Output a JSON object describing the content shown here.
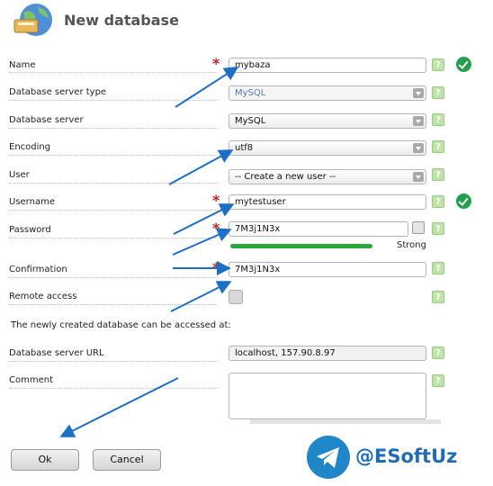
{
  "dialog": {
    "title": "New database"
  },
  "fields": {
    "name": {
      "label": "Name",
      "value": "mybaza"
    },
    "server_type": {
      "label": "Database server type",
      "value": "MySQL"
    },
    "server": {
      "label": "Database server",
      "value": "MySQL"
    },
    "encoding": {
      "label": "Encoding",
      "value": "utf8"
    },
    "user": {
      "label": "User",
      "value": "-- Create a new user --"
    },
    "username": {
      "label": "Username",
      "value": "mytestuser"
    },
    "password": {
      "label": "Password",
      "value": "7M3j1N3x",
      "strength_label": "Strong",
      "strength_fraction": 0.72
    },
    "confirmation": {
      "label": "Confirmation",
      "value": "7M3j1N3x"
    },
    "remote_access": {
      "label": "Remote access"
    },
    "access_info": "The newly created database can be accessed at:",
    "server_url": {
      "label": "Database server URL",
      "value": "localhost, 157.90.8.97"
    },
    "comment": {
      "label": "Comment",
      "value": ""
    }
  },
  "help_glyph": "?",
  "required_glyph": "*",
  "buttons": {
    "ok": "Ok",
    "cancel": "Cancel"
  },
  "watermark": {
    "text": "@ESoftUz"
  },
  "colors": {
    "accent_arrow": "#1c6fc4",
    "check_green": "#22a04b",
    "strength_green": "#2aa83a",
    "required_red": "#cc2222"
  }
}
